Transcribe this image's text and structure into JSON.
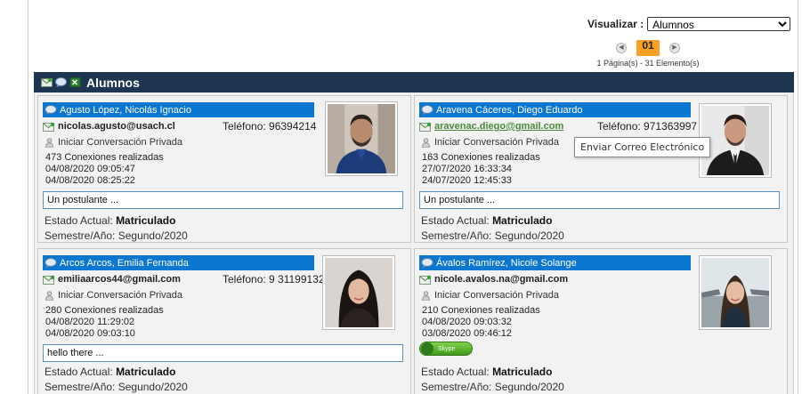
{
  "visualizar": {
    "label": "Visualizar :",
    "selected": "Alumnos"
  },
  "pager": {
    "current_page": "01",
    "info": "1 Página(s) - 31 Elemento(s)"
  },
  "section": {
    "title": "Alumnos"
  },
  "colors": {
    "header_bg": "#1d3550",
    "name_bar": "#0b77d0",
    "page_highlight": "#f9a025",
    "email_link": "#4a8a3a"
  },
  "students": [
    {
      "name": "Agusto López, Nicolás Ignacio",
      "email": "nicolas.agusto@usach.cl",
      "phone": "Teléfono: 96394214",
      "conversation": "Iniciar Conversación Privada",
      "connections": "473 Conexiones realizadas",
      "date1": "04/08/2020 09:05:47",
      "date2": "04/08/2020 08:25:22",
      "message": "Un postulante ...",
      "status_label": "Estado Actual:",
      "status_value": "Matriculado",
      "semester_label": "Semestre/Año:",
      "semester_value": "Segundo/2020"
    },
    {
      "name": "Aravena Cáceres, Diego Eduardo",
      "email": "aravenac.diego@gmail.com",
      "phone": "Teléfono: 971363997",
      "conversation": "Iniciar Conversación Privada",
      "connections": "163 Conexiones realizadas",
      "date1": "27/07/2020 16:33:34",
      "date2": "24/07/2020 12:45:33",
      "message": "Un postulante ...",
      "status_label": "Estado Actual:",
      "status_value": "Matriculado",
      "semester_label": "Semestre/Año:",
      "semester_value": "Segundo/2020"
    },
    {
      "name": "Arcos Arcos, Emilia Fernanda",
      "email": "emiliaarcos44@gmail.com",
      "phone": "Teléfono: 9 31199132",
      "conversation": "Iniciar Conversación Privada",
      "connections": "280 Conexiones realizadas",
      "date1": "04/08/2020 11:29:02",
      "date2": "04/08/2020 09:03:10",
      "message": "hello there ...",
      "status_label": "Estado Actual:",
      "status_value": "Matriculado",
      "semester_label": "Semestre/Año:",
      "semester_value": "Segundo/2020"
    },
    {
      "name": "Ávalos Ramírez, Nicole Solange",
      "email": "nicole.avalos.na@gmail.com",
      "conversation": "Iniciar Conversación Privada",
      "connections": "210 Conexiones realizadas",
      "date1": "04/08/2020 09:03:32",
      "date2": "03/08/2020 09:46:12",
      "skype": "Skype",
      "status_label": "Estado Actual:",
      "status_value": "Matriculado",
      "semester_label": "Semestre/Año:",
      "semester_value": "Segundo/2020"
    }
  ],
  "tooltip": {
    "text": "Enviar Correo Electrónico"
  }
}
